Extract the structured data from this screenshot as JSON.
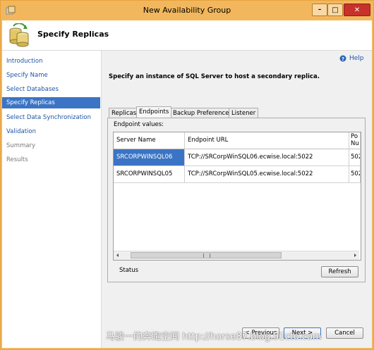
{
  "window": {
    "title": "New Availability Group",
    "controls": {
      "minimize": "–",
      "maximize": "□",
      "close": "✕"
    }
  },
  "header": {
    "title": "Specify Replicas",
    "icon": "replicas-db-icon"
  },
  "nav": {
    "items": [
      {
        "label": "Introduction",
        "state": "link"
      },
      {
        "label": "Specify Name",
        "state": "link"
      },
      {
        "label": "Select Databases",
        "state": "link"
      },
      {
        "label": "Specify Replicas",
        "state": "selected"
      },
      {
        "label": "Select Data Synchronization",
        "state": "link"
      },
      {
        "label": "Validation",
        "state": "link"
      },
      {
        "label": "Summary",
        "state": "disabled"
      },
      {
        "label": "Results",
        "state": "disabled"
      }
    ]
  },
  "help": {
    "label": "Help"
  },
  "instruction": "Specify an instance of SQL Server to host a secondary replica.",
  "tabs": [
    {
      "label": "Replicas",
      "active": false
    },
    {
      "label": "Endpoints",
      "active": true
    },
    {
      "label": "Backup Preferences",
      "active": false
    },
    {
      "label": "Listener",
      "active": false
    }
  ],
  "endpoints": {
    "label": "Endpoint values:",
    "columns": [
      "Server Name",
      "Endpoint URL",
      "Po Nu"
    ],
    "rows": [
      {
        "server": "SRCORPWINSQL06",
        "url": "TCP://SRCorpWinSQL06.ecwise.local:5022",
        "port": "502",
        "selected": true
      },
      {
        "server": "SRCORPWINSQL05",
        "url": "TCP://SRCorpWinSQL05.ecwise.local:5022",
        "port": "502",
        "selected": false
      }
    ]
  },
  "status": {
    "label": "Status"
  },
  "buttons": {
    "refresh": "Refresh",
    "previous": "< Previous",
    "next": "Next >",
    "cancel": "Cancel"
  },
  "watermark": "马骏一的奔跑空间 http://horse87.blog.51cto.com",
  "colors": {
    "frame": "#f2b75c",
    "selection": "#3b74c4",
    "link": "#1d54a6",
    "close_button": "#c7322a"
  }
}
